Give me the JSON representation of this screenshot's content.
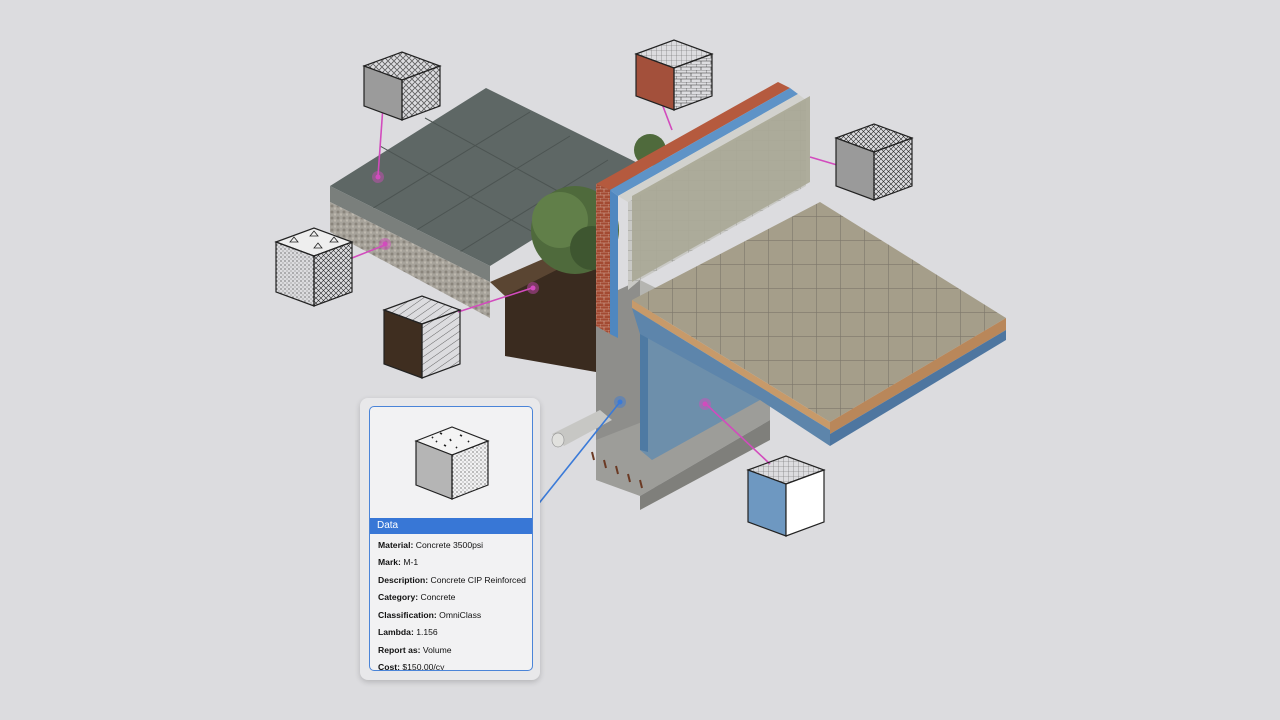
{
  "panel": {
    "header": "Data",
    "rows": [
      {
        "label": "Material:",
        "value": "Concrete 3500psi"
      },
      {
        "label": "Mark:",
        "value": "M-1"
      },
      {
        "label": "Description:",
        "value": "Concrete CIP Reinforced"
      },
      {
        "label": "Category:",
        "value": "Concrete"
      },
      {
        "label": "Classification:",
        "value": "OmniClass"
      },
      {
        "label": "Lambda:",
        "value": "1.156"
      },
      {
        "label": "Report as:",
        "value": "Volume"
      },
      {
        "label": "Cost:",
        "value": "$150.00/cy"
      }
    ]
  },
  "colors": {
    "background": "#dcdcdf",
    "leader_magenta": "#d24bbd",
    "leader_blue": "#3a7ad8",
    "header_blue": "#3877d6"
  },
  "material_swatches": [
    {
      "name": "paving-stone",
      "pattern": "hexagon"
    },
    {
      "name": "gravel",
      "pattern": "stipple-triangles"
    },
    {
      "name": "earth",
      "pattern": "diagonal-hatch"
    },
    {
      "name": "brick",
      "pattern": "brick"
    },
    {
      "name": "concrete-block",
      "pattern": "crosshatch"
    },
    {
      "name": "waterproofing",
      "pattern": "grid"
    },
    {
      "name": "concrete",
      "pattern": "stipple"
    }
  ]
}
